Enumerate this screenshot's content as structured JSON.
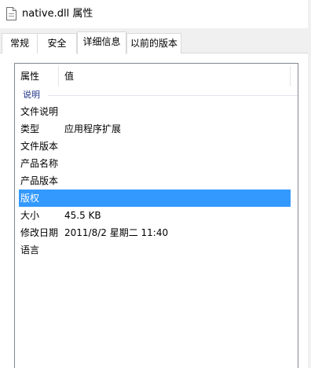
{
  "window": {
    "title": "native.dll 属性",
    "icon": "document-icon"
  },
  "tabs": [
    {
      "label": "常规",
      "active": false
    },
    {
      "label": "安全",
      "active": false
    },
    {
      "label": "详细信息",
      "active": true
    },
    {
      "label": "以前的版本",
      "active": false
    }
  ],
  "details": {
    "columns": {
      "property": "属性",
      "value": "值"
    },
    "group": "说明",
    "rows": [
      {
        "name": "文件说明",
        "value": ""
      },
      {
        "name": "类型",
        "value": "应用程序扩展"
      },
      {
        "name": "文件版本",
        "value": ""
      },
      {
        "name": "产品名称",
        "value": ""
      },
      {
        "name": "产品版本",
        "value": ""
      },
      {
        "name": "版权",
        "value": "",
        "selected": true
      },
      {
        "name": "大小",
        "value": "45.5 KB"
      },
      {
        "name": "修改日期",
        "value": "2011/8/2 星期二 11:40"
      },
      {
        "name": "语言",
        "value": ""
      }
    ]
  },
  "colors": {
    "selection": "#3399ff",
    "group_label": "#1e3287",
    "border": "#828790"
  }
}
